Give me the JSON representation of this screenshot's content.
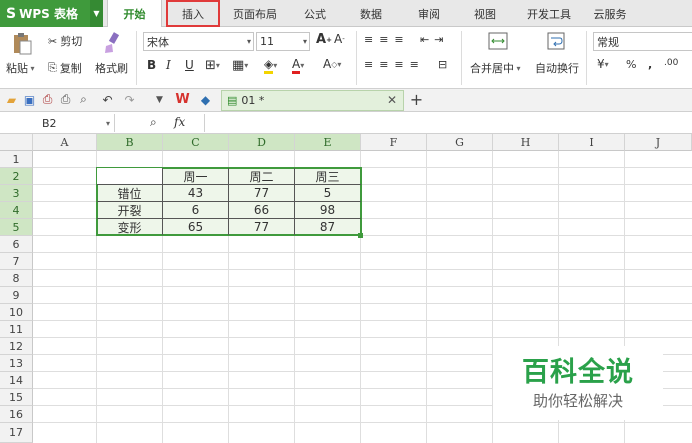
{
  "app": {
    "name": "WPS 表格"
  },
  "tabs": [
    "开始",
    "插入",
    "页面布局",
    "公式",
    "数据",
    "审阅",
    "视图",
    "开发工具",
    "云服务"
  ],
  "ribbon": {
    "paste": "粘贴",
    "cut": "剪切",
    "copy": "复制",
    "format_painter": "格式刷",
    "font_name": "宋体",
    "font_size": "11",
    "merge_center": "合并居中",
    "wrap_text": "自动换行",
    "number_format": "常规",
    "percent": "%",
    "comma": ",",
    "dec": ".00"
  },
  "quick_access": {
    "doc_tab": "01 *"
  },
  "formula_bar": {
    "name_box": "B2",
    "fx": "fx"
  },
  "columns": [
    "A",
    "B",
    "C",
    "D",
    "E",
    "F",
    "G",
    "H",
    "I",
    "J"
  ],
  "rows": [
    "1",
    "2",
    "3",
    "4",
    "5",
    "6",
    "7",
    "8",
    "9",
    "10",
    "11",
    "12",
    "13",
    "14",
    "15",
    "16",
    "17"
  ],
  "table": {
    "header": [
      "",
      "周一",
      "周二",
      "周三"
    ],
    "rows": [
      [
        "错位",
        "43",
        "77",
        "5"
      ],
      [
        "开裂",
        "6",
        "66",
        "98"
      ],
      [
        "变形",
        "65",
        "77",
        "87"
      ]
    ]
  },
  "watermark": {
    "title": "百科全说",
    "subtitle": "助你轻松解决"
  },
  "colors": {
    "accent": "#3f9a3c",
    "highlight": "#e03a3a"
  }
}
